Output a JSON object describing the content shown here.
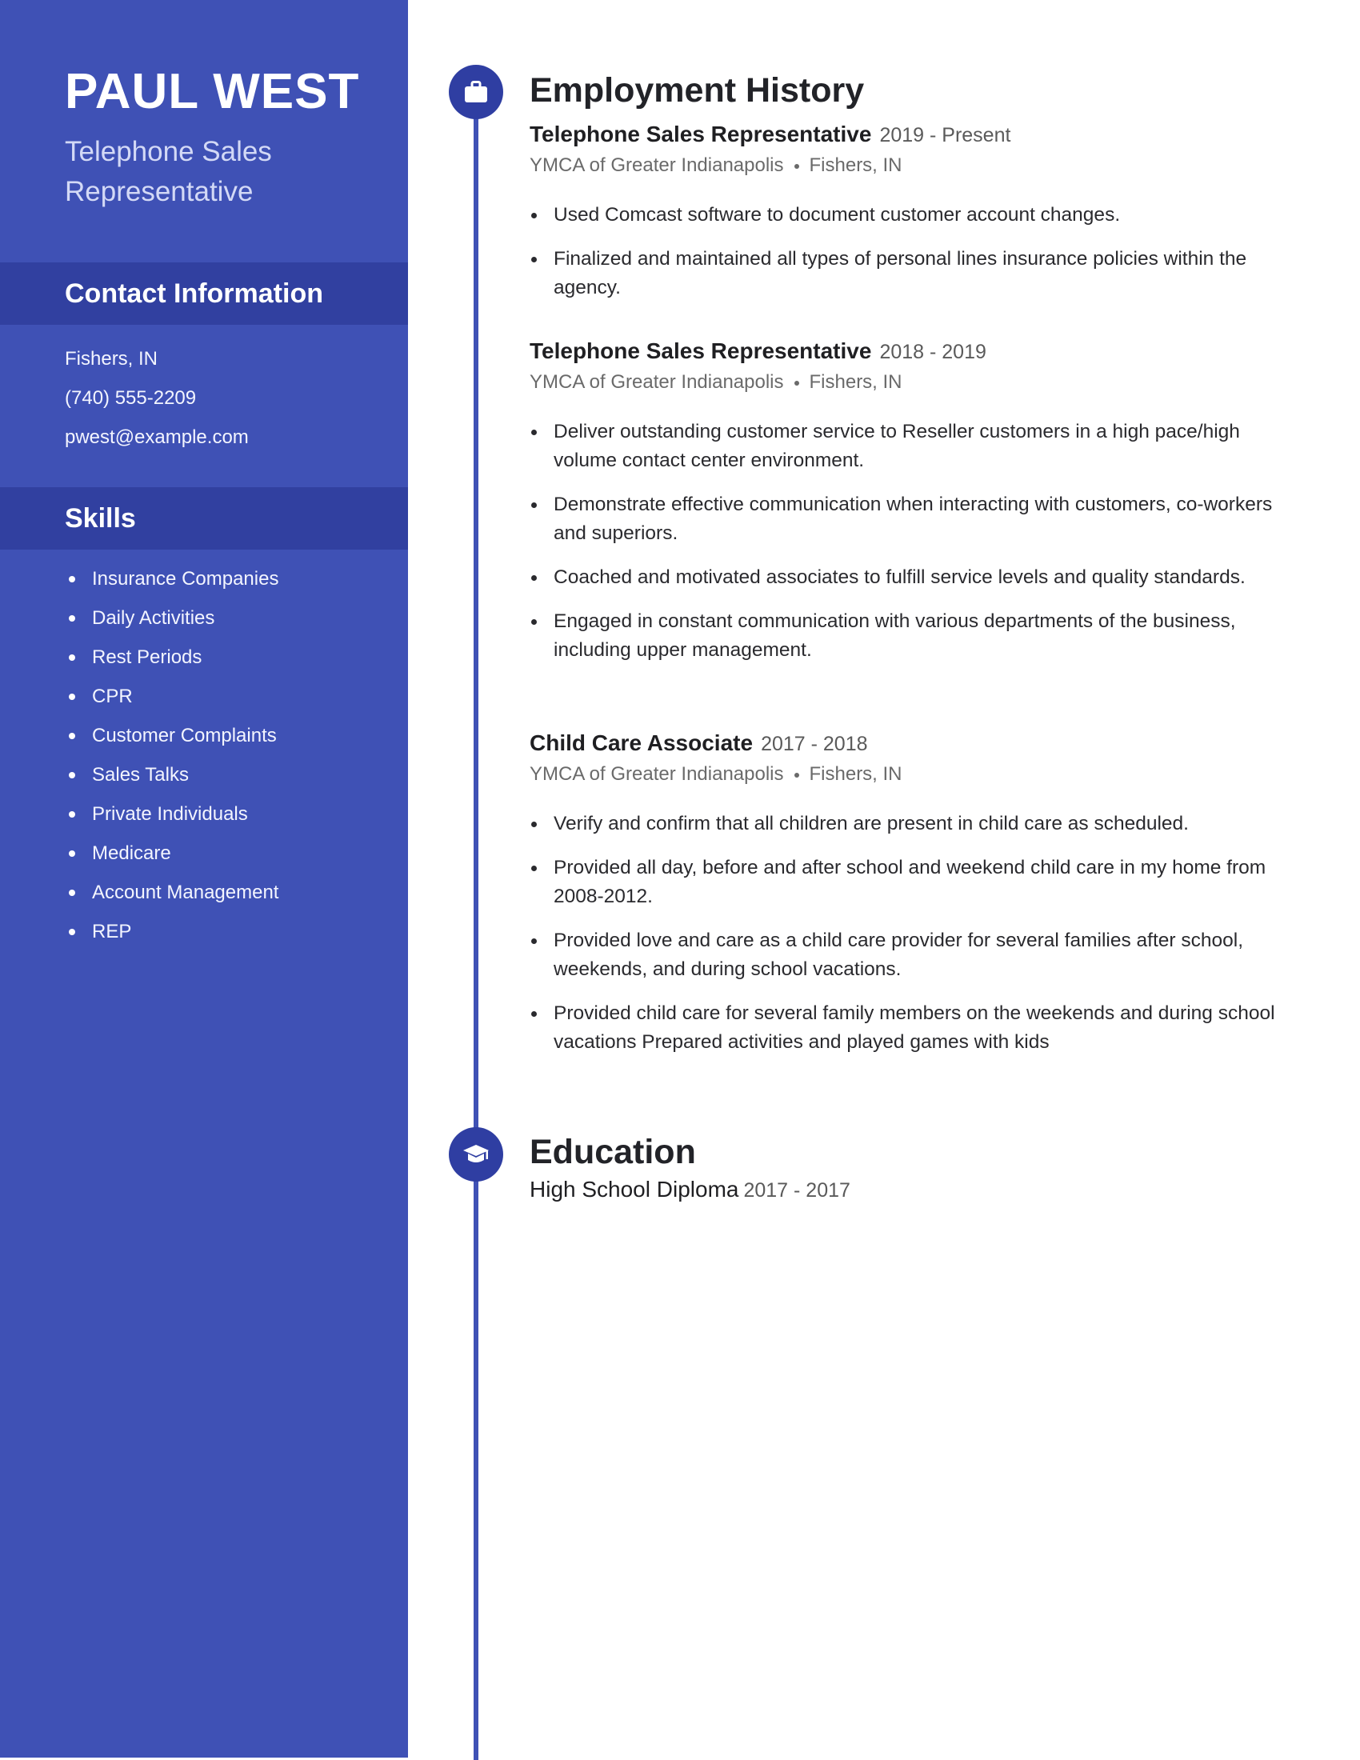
{
  "sidebar": {
    "name": "PAUL WEST",
    "title": "Telephone Sales Representative",
    "contact": {
      "heading": "Contact Information",
      "location": "Fishers, IN",
      "phone": "(740) 555-2209",
      "email": "pwest@example.com"
    },
    "skills": {
      "heading": "Skills",
      "items": [
        "Insurance Companies",
        "Daily Activities",
        "Rest Periods",
        "CPR",
        "Customer Complaints",
        "Sales Talks",
        "Private Individuals",
        "Medicare",
        "Account Management",
        "REP"
      ]
    }
  },
  "employment": {
    "heading": "Employment History",
    "icon": "briefcase-icon",
    "jobs": [
      {
        "role": "Telephone Sales Representative",
        "dates": "2019 - Present",
        "company": "YMCA of Greater Indianapolis",
        "location": "Fishers, IN",
        "bullets": [
          "Used Comcast software to document customer account changes.",
          "Finalized and maintained all types of personal lines insurance policies within the agency."
        ]
      },
      {
        "role": "Telephone Sales Representative",
        "dates": "2018 - 2019",
        "company": "YMCA of Greater Indianapolis",
        "location": "Fishers, IN",
        "bullets": [
          "Deliver outstanding customer service to Reseller customers in a high pace/high volume contact center environment.",
          "Demonstrate effective communication when interacting with customers, co-workers and superiors.",
          "Coached and motivated associates to fulfill service levels and quality standards.",
          "Engaged in constant communication with various departments of the business, including upper management."
        ]
      },
      {
        "role": "Child Care Associate",
        "dates": "2017 - 2018",
        "company": "YMCA of Greater Indianapolis",
        "location": "Fishers, IN",
        "bullets": [
          "Verify and confirm that all children are present in child care as scheduled.",
          "Provided all day, before and after school and weekend child care in my home from 2008-2012.",
          "Provided love and care as a child care provider for several families after school, weekends, and during school vacations.",
          "Provided child care for several family members on the weekends and during school vacations Prepared activities and played games with kids"
        ]
      }
    ]
  },
  "education": {
    "heading": "Education",
    "icon": "graduation-cap-icon",
    "items": [
      {
        "degree": "High School Diploma",
        "dates": "2017 - 2017"
      }
    ]
  },
  "colors": {
    "sidebar": "#3f51b5",
    "sidebar_band": "#3140a0",
    "timeline_node": "#2f3ea2",
    "text_dark": "#222328",
    "text_muted": "#6a6a6a"
  }
}
